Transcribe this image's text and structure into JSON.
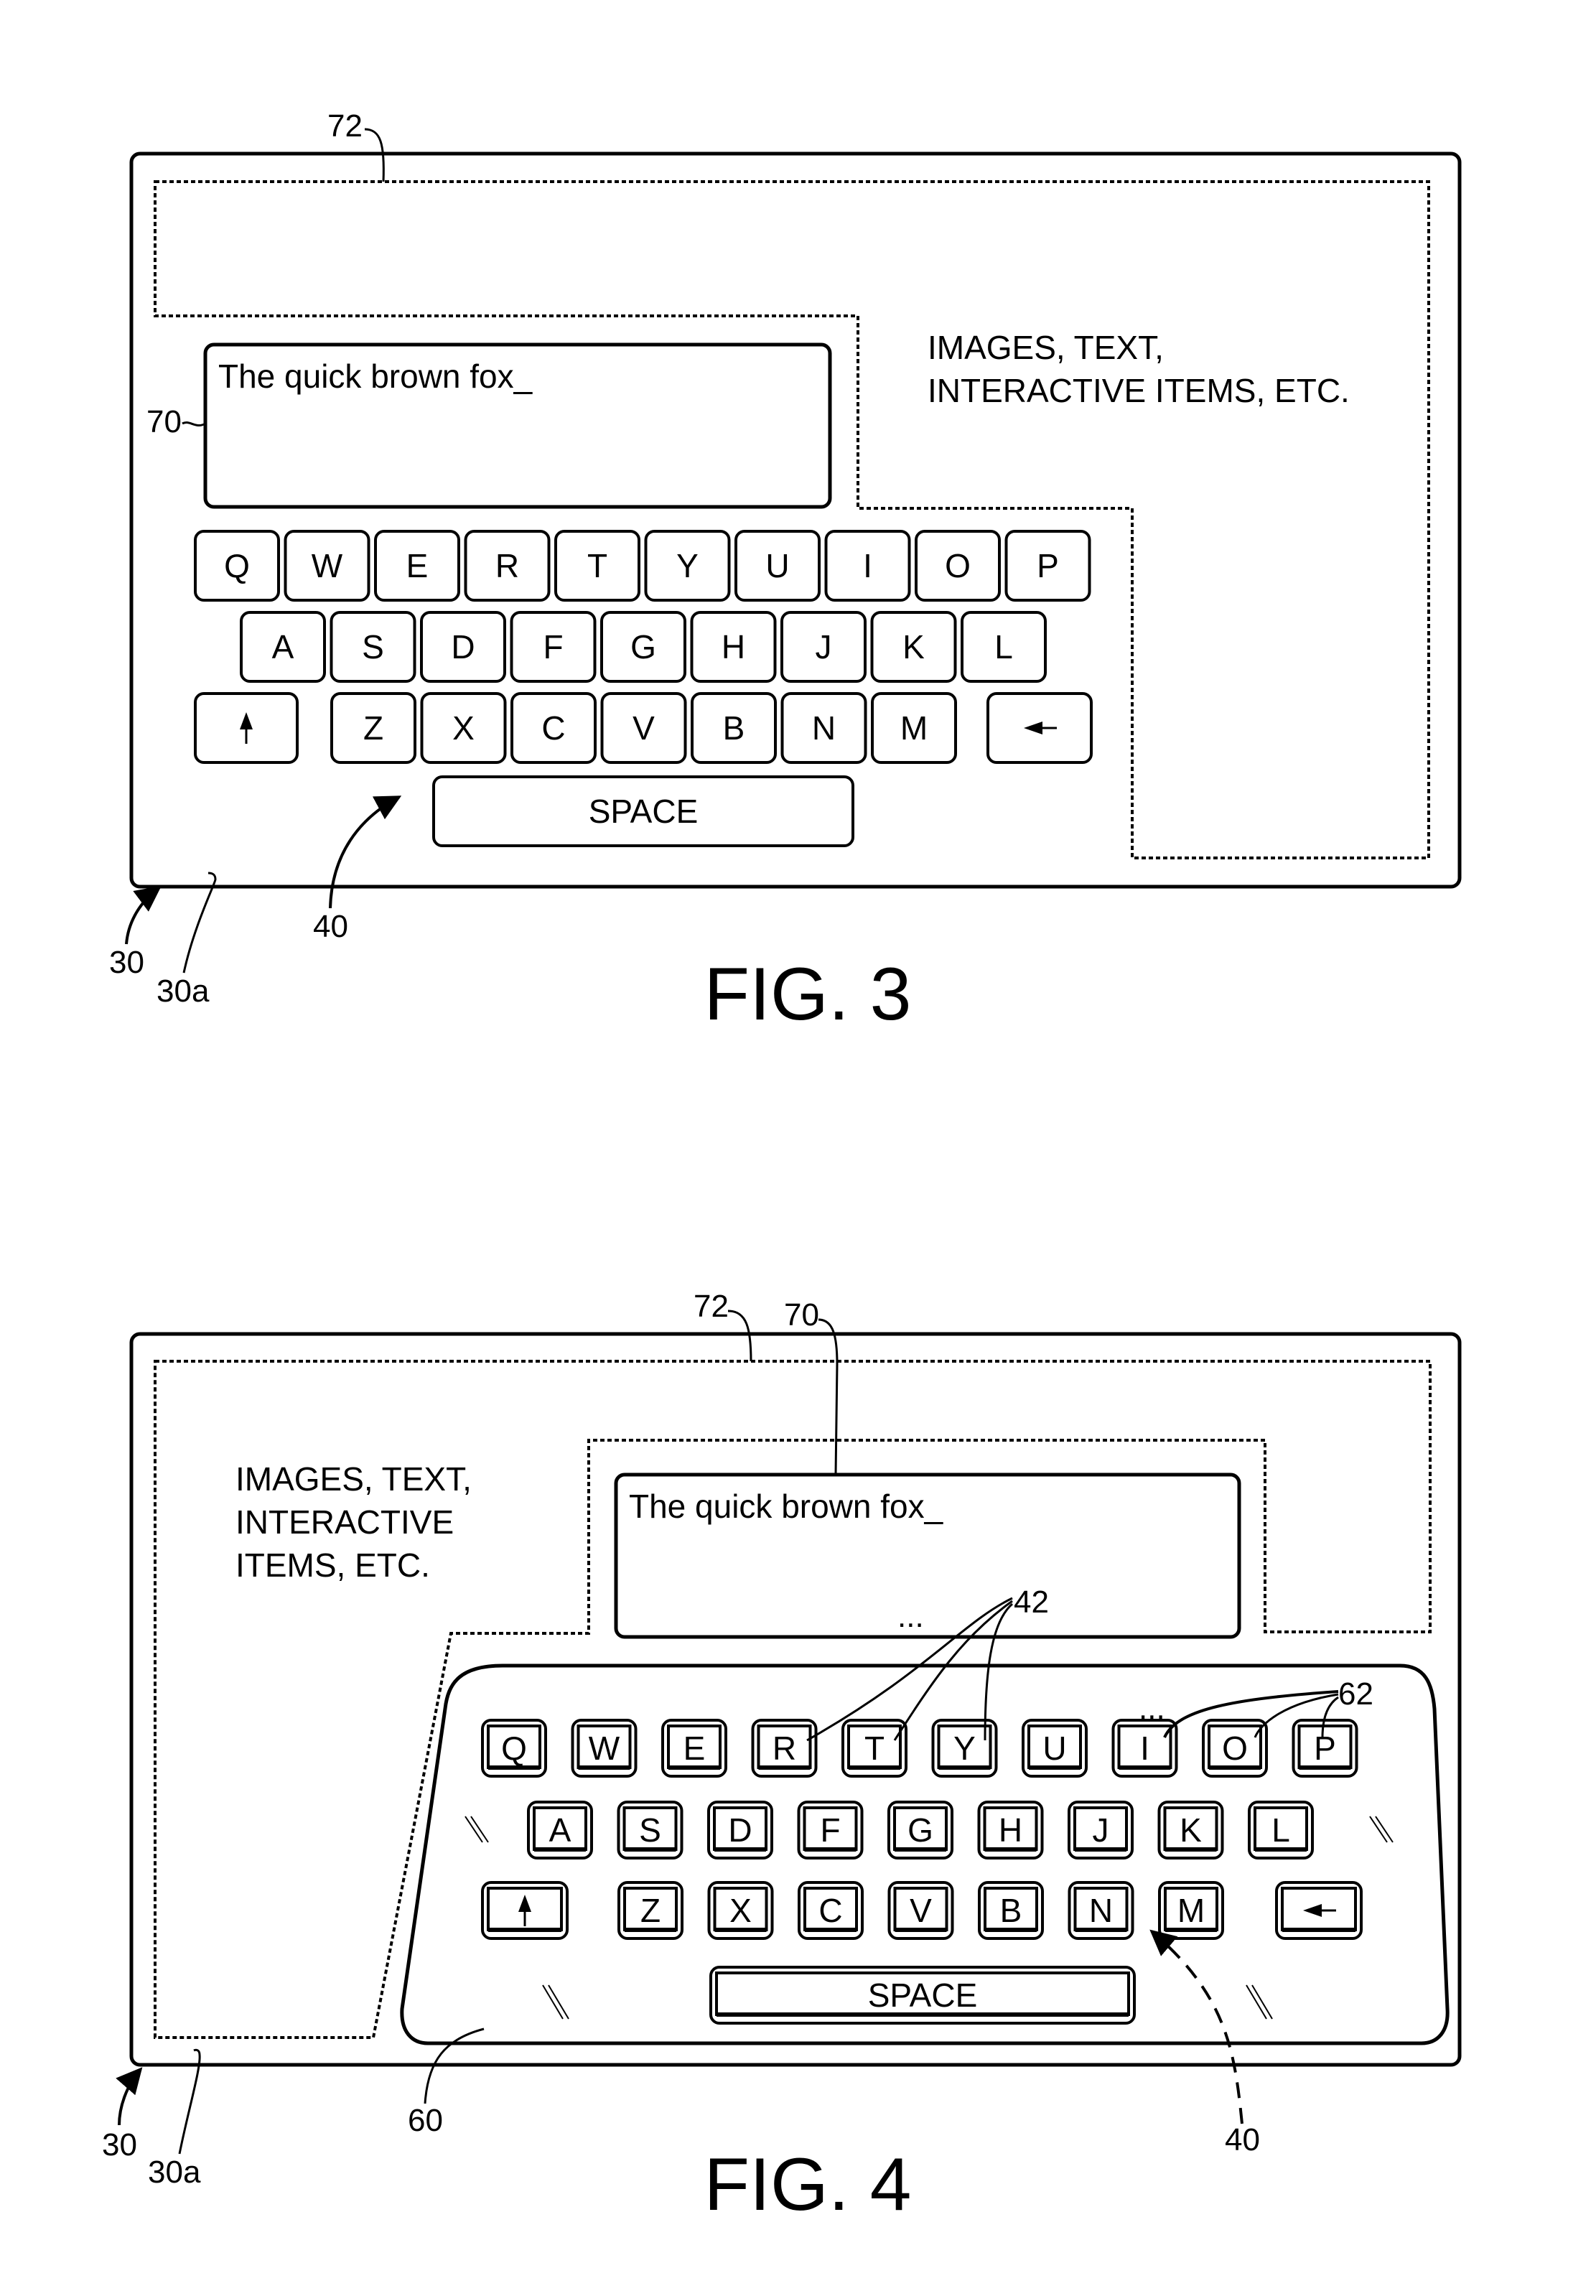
{
  "figures": [
    {
      "id": "fig3",
      "caption": "FIG. 3",
      "text_field": "The quick brown fox_",
      "content_lines": [
        "IMAGES, TEXT,",
        "INTERACTIVE ITEMS, ETC."
      ],
      "keys": {
        "row1": [
          "Q",
          "W",
          "E",
          "R",
          "T",
          "Y",
          "U",
          "I",
          "O",
          "P"
        ],
        "row2": [
          "A",
          "S",
          "D",
          "F",
          "G",
          "H",
          "J",
          "K",
          "L"
        ],
        "row3": [
          "Z",
          "X",
          "C",
          "V",
          "B",
          "N",
          "M"
        ],
        "shift_icon": "up-arrow",
        "backspace_icon": "left-arrow",
        "space": "SPACE"
      },
      "refs": {
        "device": "30",
        "display": "30a",
        "keyboard": "40",
        "text_field": "70",
        "content_region": "72"
      }
    },
    {
      "id": "fig4",
      "caption": "FIG. 4",
      "text_field": "The quick brown fox_",
      "content_lines": [
        "IMAGES, TEXT,",
        "INTERACTIVE",
        "ITEMS, ETC."
      ],
      "keys": {
        "row1": [
          "Q",
          "W",
          "E",
          "R",
          "T",
          "Y",
          "U",
          "I",
          "O",
          "P"
        ],
        "row2": [
          "A",
          "S",
          "D",
          "F",
          "G",
          "H",
          "J",
          "K",
          "L"
        ],
        "row3": [
          "Z",
          "X",
          "C",
          "V",
          "B",
          "N",
          "M"
        ],
        "shift_icon": "up-arrow",
        "backspace_icon": "left-arrow",
        "space": "SPACE"
      },
      "refs": {
        "device": "30",
        "display": "30a",
        "keyboard": "40",
        "keys_group": "42",
        "overlay": "60",
        "key_outlines": "62",
        "text_field": "70",
        "content_region": "72",
        "ellipsis": "..."
      }
    }
  ]
}
